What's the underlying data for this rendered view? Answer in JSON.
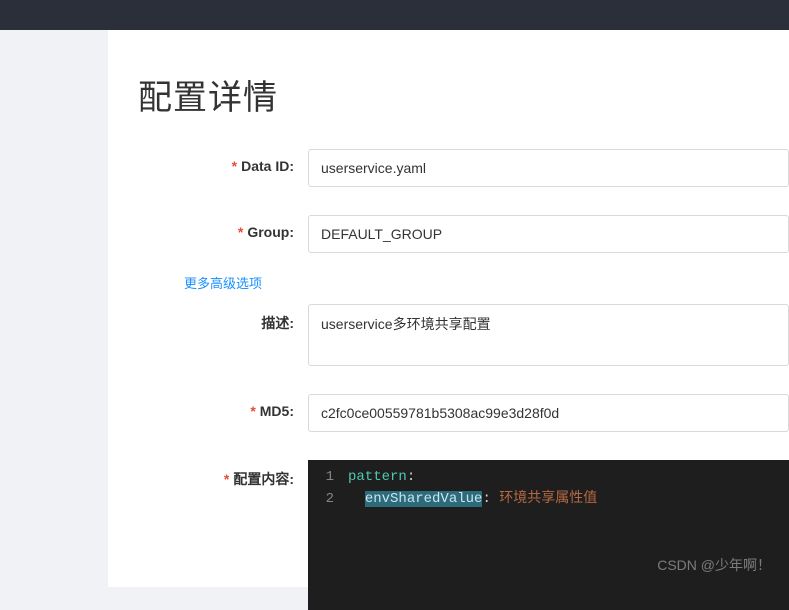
{
  "page": {
    "title": "配置详情"
  },
  "form": {
    "dataId": {
      "label": "Data ID:",
      "value": "userservice.yaml"
    },
    "group": {
      "label": "Group:",
      "value": "DEFAULT_GROUP"
    },
    "advancedLink": "更多高级选项",
    "description": {
      "label": "描述:",
      "value": "userservice多环境共享配置"
    },
    "md5": {
      "label": "MD5:",
      "value": "c2fc0ce00559781b5308ac99e3d28f0d"
    },
    "content": {
      "label": "配置内容:",
      "lines": [
        {
          "num": "1",
          "key": "pattern",
          "indent": ""
        },
        {
          "num": "2",
          "key": "envSharedValue",
          "indent": "  ",
          "value": "环境共享属性值",
          "keySelected": true
        }
      ]
    }
  },
  "watermark": "CSDN @少年啊！"
}
